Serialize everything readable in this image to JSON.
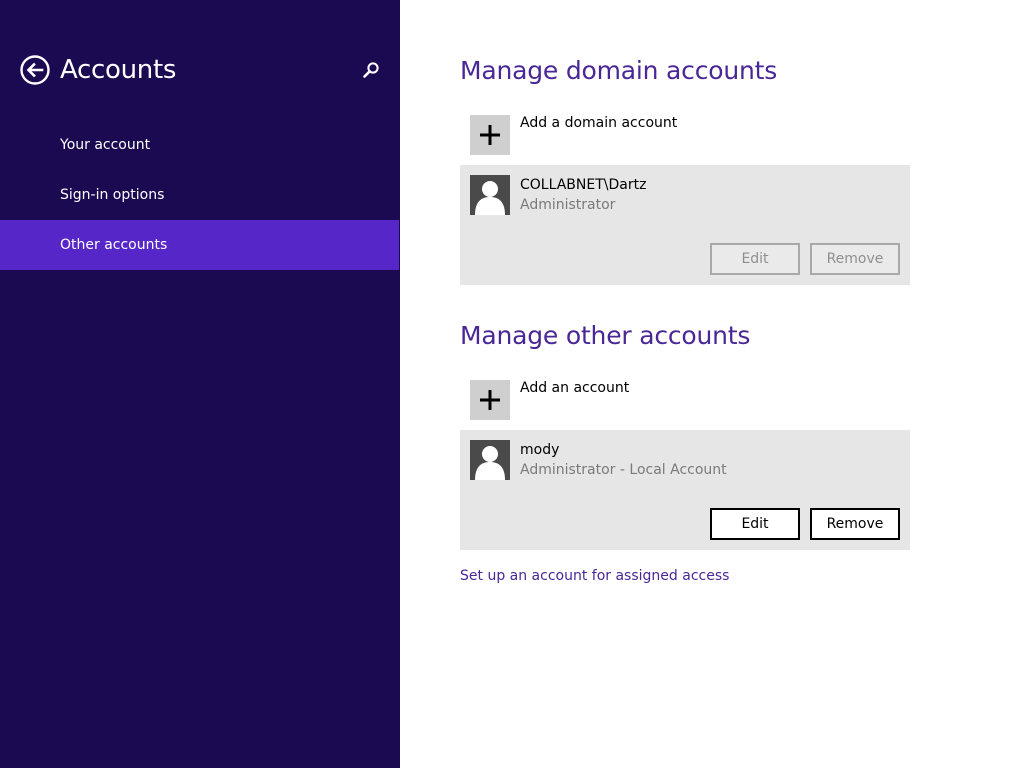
{
  "sidebar": {
    "title": "Accounts",
    "back_icon": "arrow-left-circle-icon",
    "search_icon": "search-icon",
    "items": [
      {
        "label": "Your account",
        "selected": false
      },
      {
        "label": "Sign-in options",
        "selected": false
      },
      {
        "label": "Other accounts",
        "selected": true
      }
    ]
  },
  "domain": {
    "title": "Manage domain accounts",
    "add_label": "Add a domain account",
    "account": {
      "name": "COLLABNET\\Dartz",
      "role": "Administrator",
      "edit_label": "Edit",
      "remove_label": "Remove",
      "buttons_enabled": false
    }
  },
  "other": {
    "title": "Manage other accounts",
    "add_label": "Add an account",
    "account": {
      "name": "mody",
      "role": "Administrator - Local Account",
      "edit_label": "Edit",
      "remove_label": "Remove",
      "buttons_enabled": true
    }
  },
  "assigned_access_link": "Set up an account for assigned access",
  "colors": {
    "sidebar_bg": "#1b0a52",
    "sidebar_selected": "#5626c8",
    "accent": "#4a2797",
    "card_bg": "#e6e6e6"
  }
}
